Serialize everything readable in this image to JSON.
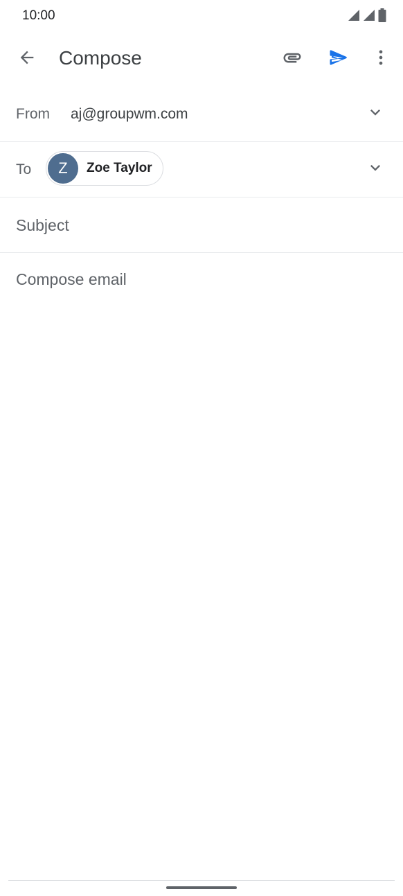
{
  "status_bar": {
    "time": "10:00",
    "icons": [
      "signal-icon",
      "signal-icon",
      "battery-icon"
    ]
  },
  "top_bar": {
    "title": "Compose",
    "icons": {
      "back": "arrow-back-icon",
      "attach": "paperclip-icon",
      "send": "send-icon",
      "more": "more-vert-icon"
    },
    "accent_color": "#1a73e8"
  },
  "from_field": {
    "label": "From",
    "value": "aj@groupwm.com"
  },
  "to_field": {
    "label": "To",
    "recipients": [
      {
        "initial": "Z",
        "name": "Zoe Taylor",
        "avatar_color": "#4f6d8f"
      }
    ]
  },
  "subject_field": {
    "placeholder": "Subject",
    "value": ""
  },
  "body_field": {
    "placeholder": "Compose email",
    "value": ""
  }
}
